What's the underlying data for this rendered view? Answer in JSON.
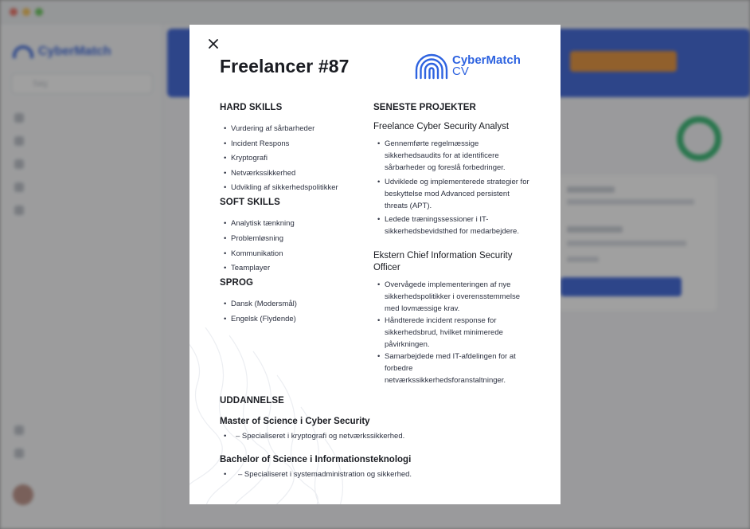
{
  "background": {
    "brand": "CyberMatch",
    "search_placeholder": "Søg",
    "accent": "#2e59d6",
    "cta_color": "#e38a2d",
    "success_color": "#29b36a"
  },
  "modal": {
    "title": "Freelancer #87",
    "logo": {
      "line1": "CyberMatch",
      "line2": "CV"
    },
    "hard_skills": {
      "heading": "HARD SKILLS",
      "items": [
        "Vurdering af sårbarheder",
        "Incident Respons",
        "Kryptografi",
        "Netværkssikkerhed",
        "Udvikling af sikkerhedspolitikker"
      ]
    },
    "soft_skills": {
      "heading": "SOFT SKILLS",
      "items": [
        "Analytisk tænkning",
        "Problemløsning",
        "Kommunikation",
        "Teamplayer"
      ]
    },
    "languages": {
      "heading": "SPROG",
      "items": [
        "Dansk (Modersmål)",
        "Engelsk (Flydende)"
      ]
    },
    "projects": {
      "heading": "SENESTE PROJEKTER",
      "items": [
        {
          "title": "Freelance Cyber Security Analyst",
          "bullets": [
            "Gennemførte regelmæssige sikkerhedsaudits for at identificere sårbarheder og foreslå forbedringer.",
            "Udviklede og implementerede strategier for beskyttelse mod Advanced persistent threats (APT).",
            "Ledede træningssessioner i IT-sikkerhedsbevidsthed for medarbejdere."
          ]
        },
        {
          "title": "Ekstern Chief Information Security Officer",
          "bullets": [
            "Overvågede implementeringen af nye sikkerhedspolitikker i overensstemmelse med lovmæssige krav.",
            "Håndterede incident response for sikkerhedsbrud, hvilket minimerede påvirkningen.",
            "Samarbejdede med IT-afdelingen for at forbedre netværkssikkerhedsforanstaltninger."
          ]
        }
      ]
    },
    "education": {
      "heading": "UDDANNELSE",
      "items": [
        {
          "degree": "Master of Science i Cyber Security",
          "note": "– Specialiseret i kryptografi og netværkssikkerhed."
        },
        {
          "degree": "Bachelor of Science i Informationsteknologi",
          "note": "– Specialiseret i systemadministration og sikkerhed."
        }
      ]
    }
  }
}
